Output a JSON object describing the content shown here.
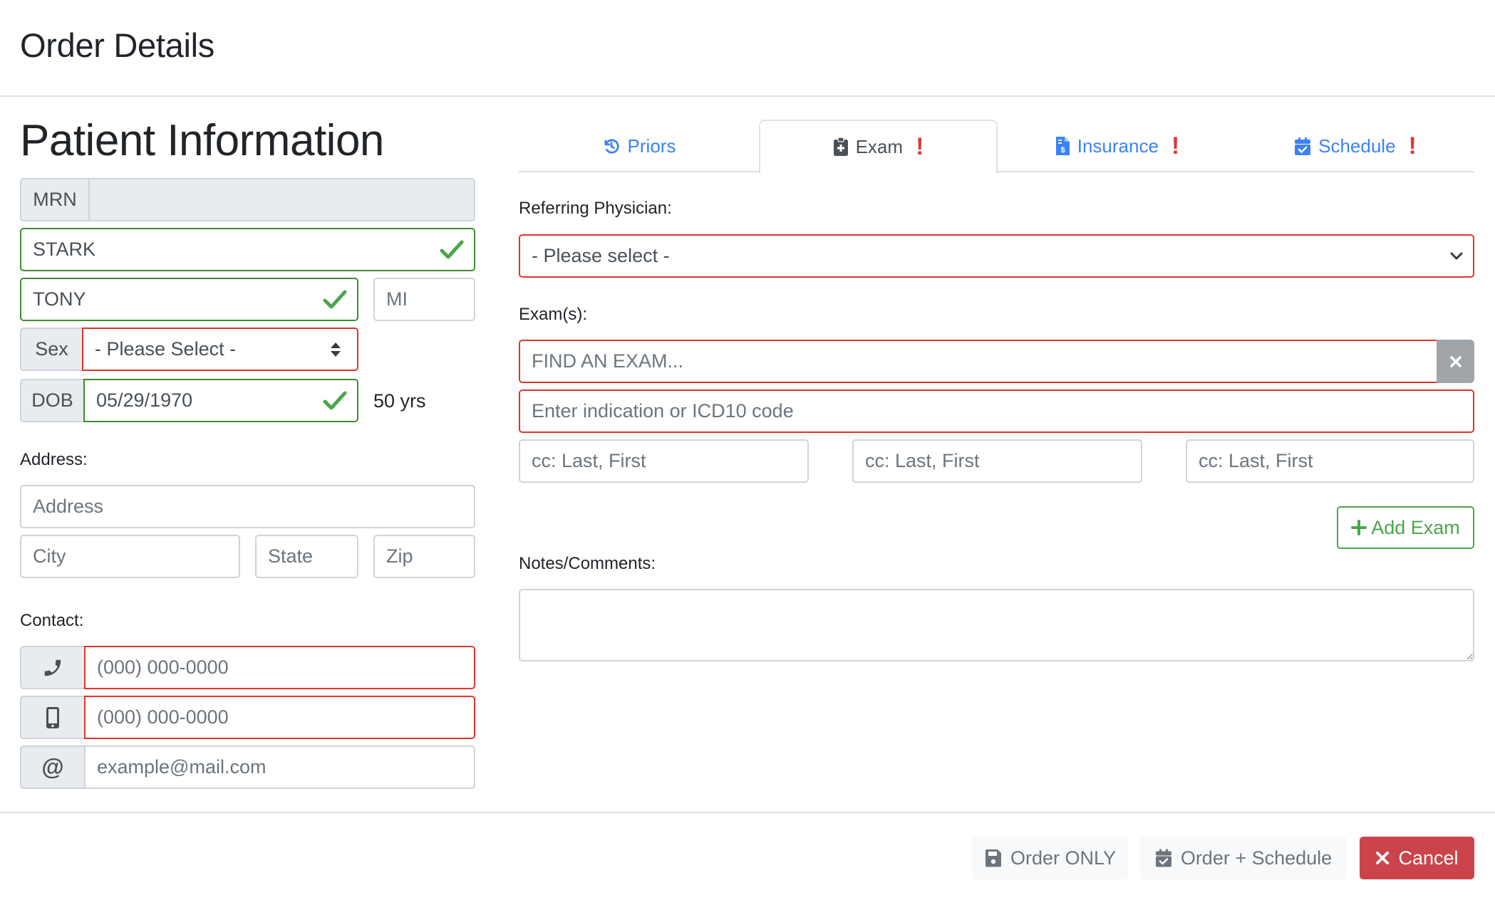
{
  "modal": {
    "title": "Order Details"
  },
  "patient": {
    "section_title": "Patient Information",
    "mrn": {
      "label": "MRN",
      "value": ""
    },
    "last_name": {
      "value": "STARK",
      "status": "valid"
    },
    "first_name": {
      "value": "TONY",
      "status": "valid"
    },
    "middle_initial": {
      "placeholder": "MI",
      "value": ""
    },
    "sex": {
      "label": "Sex",
      "selected": "- Please Select -",
      "status": "invalid"
    },
    "dob": {
      "label": "DOB",
      "value": "05/29/1970",
      "status": "valid"
    },
    "age": "50 yrs",
    "address_label": "Address:",
    "address": {
      "placeholder": "Address"
    },
    "city": {
      "placeholder": "City"
    },
    "state": {
      "placeholder": "State"
    },
    "zip": {
      "placeholder": "Zip"
    },
    "contact_label": "Contact:",
    "phone": {
      "icon": "phone-icon",
      "placeholder": "(000) 000-0000",
      "status": "invalid"
    },
    "mobile": {
      "icon": "mobile-phone-icon",
      "placeholder": "(000) 000-0000",
      "status": "invalid"
    },
    "email": {
      "icon": "at-sign-icon",
      "placeholder": "example@mail.com"
    }
  },
  "tabs": [
    {
      "label": "Priors",
      "icon": "history-icon",
      "active": false,
      "alert": false
    },
    {
      "label": "Exam",
      "icon": "clipboard-medical-icon",
      "active": true,
      "alert": true
    },
    {
      "label": "Insurance",
      "icon": "invoice-dollar-icon",
      "active": false,
      "alert": true
    },
    {
      "label": "Schedule",
      "icon": "calendar-check-icon",
      "active": false,
      "alert": true
    }
  ],
  "alert_glyph": "!",
  "exam": {
    "referring_label": "Referring Physician:",
    "referring_selected": "- Please select -",
    "exams_label": "Exam(s):",
    "find_exam_placeholder": "FIND AN EXAM...",
    "indication_placeholder": "Enter indication or ICD10 code",
    "cc_placeholders": [
      "cc: Last, First",
      "cc: Last, First",
      "cc: Last, First"
    ],
    "add_exam_label": "Add Exam",
    "notes_label": "Notes/Comments:",
    "notes_value": ""
  },
  "footer": {
    "order_only_label": "Order ONLY",
    "order_schedule_label": "Order + Schedule",
    "cancel_label": "Cancel"
  },
  "colors": {
    "valid": "#3f8b2e",
    "invalid": "#e0352b",
    "link": "#3b82f6",
    "danger": "#cc444b",
    "success": "#4aa64a",
    "alert": "#d33a3f"
  }
}
